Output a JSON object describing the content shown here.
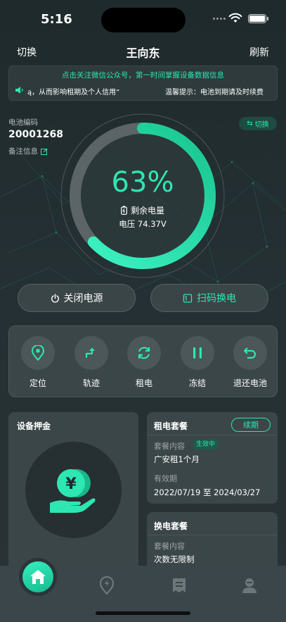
{
  "status_bar": {
    "time": "5:16"
  },
  "header": {
    "left_label": "切换",
    "title": "王向东",
    "right_label": "刷新"
  },
  "notice": {
    "line1": "点击关注微信公众号，第一时间掌握设备数据信息",
    "scroll_text": "ą，从而影响租期及个人信用”",
    "tip": "温馨提示：电池到期请及时续费"
  },
  "battery_info": {
    "code_label": "电池编码",
    "code_value": "20001268",
    "remark_label": "备注信息",
    "switch_label": "切换"
  },
  "gauge": {
    "percent_text": "63%",
    "percent": 63,
    "remain_label": "剩余电量",
    "voltage_text": "电压 74.37V"
  },
  "buttons": {
    "power_off": "关闭电源",
    "scan_swap": "扫码换电"
  },
  "actions": [
    {
      "label": "定位",
      "icon": "location-pin-icon"
    },
    {
      "label": "轨迹",
      "icon": "track-arrow-icon"
    },
    {
      "label": "租电",
      "icon": "refresh-icon"
    },
    {
      "label": "冻结",
      "icon": "pause-icon"
    },
    {
      "label": "退还电池",
      "icon": "return-icon"
    }
  ],
  "deposit": {
    "title": "设备押金",
    "icon": "yen-coin-hand-icon"
  },
  "rent_plan": {
    "title": "租电套餐",
    "renew_label": "续期",
    "content_label": "套餐内容",
    "status_badge": "生效中",
    "content_value": "广安租1个月",
    "validity_label": "有效期",
    "validity_value": "2022/07/19 至 2024/03/27"
  },
  "swap_plan": {
    "title": "换电套餐",
    "content_label": "套餐内容",
    "content_value": "次数无限制"
  },
  "tabbar": [
    {
      "name": "home",
      "icon": "home-icon",
      "active": true
    },
    {
      "name": "swap-station",
      "icon": "lightning-pin-icon"
    },
    {
      "name": "orders",
      "icon": "list-icon"
    },
    {
      "name": "profile",
      "icon": "user-icon"
    }
  ],
  "colors": {
    "accent": "#2EE6B2",
    "background": "#243033",
    "card": "#3B4649"
  }
}
